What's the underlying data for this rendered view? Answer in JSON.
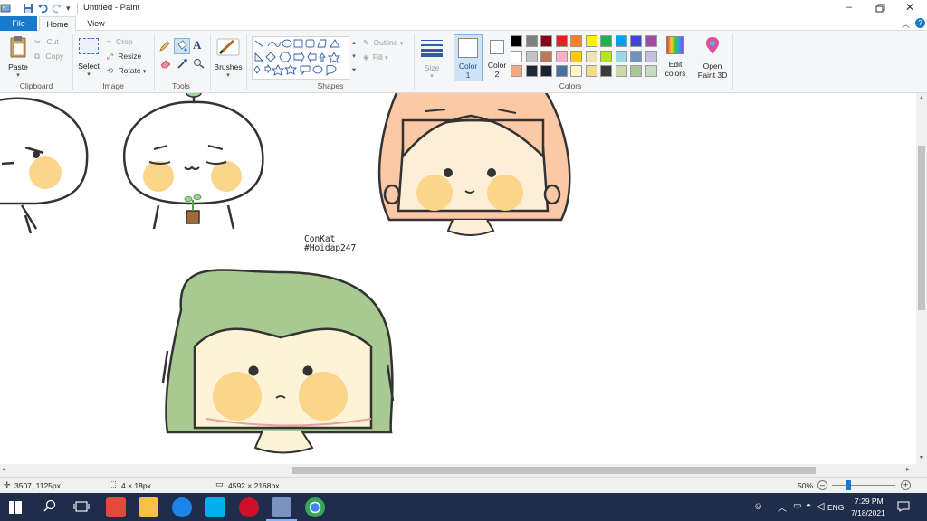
{
  "window": {
    "title": "Untitled - Paint"
  },
  "tabs": {
    "file": "File",
    "home": "Home",
    "view": "View"
  },
  "ribbon": {
    "clipboard": {
      "paste": "Paste",
      "cut": "Cut",
      "copy": "Copy",
      "label": "Clipboard"
    },
    "image": {
      "select": "Select",
      "crop": "Crop",
      "resize": "Resize",
      "rotate": "Rotate",
      "label": "Image"
    },
    "tools": {
      "label": "Tools"
    },
    "brushes": {
      "label": "Brushes"
    },
    "shapes": {
      "outline": "Outline",
      "fill": "Fill",
      "label": "Shapes"
    },
    "size": {
      "label": "Size"
    },
    "colors": {
      "color1": "Color",
      "color1_num": "1",
      "color2": "Color",
      "color2_num": "2",
      "edit": "Edit",
      "edit2": "colors",
      "label": "Colors",
      "row1": [
        "#000000",
        "#7f7f7f",
        "#880015",
        "#ed1c24",
        "#ff7f27",
        "#fff200",
        "#22b14c",
        "#00a2e8",
        "#3f48cc",
        "#a349a4"
      ],
      "row2": [
        "#ffffff",
        "#c3c3c3",
        "#b97a57",
        "#ffaec9",
        "#ffc90e",
        "#efe4b0",
        "#b5e61d",
        "#99d9ea",
        "#7092be",
        "#c8bfe7"
      ],
      "row3": [
        "#f4a880",
        "#1e2a3a",
        "#1a2233",
        "#4a6fa5",
        "#fff6cc",
        "#f7d98a",
        "#3a3a3a",
        "#cbd9a6",
        "#a8c89a",
        "#c6dcc0"
      ]
    },
    "paint3d": {
      "line1": "Open",
      "line2": "Paint 3D"
    }
  },
  "canvas": {
    "watermark_line1": "ConKat",
    "watermark_line2": "#Hoidap247"
  },
  "status": {
    "cursor_pos": "3507, 1125px",
    "selection_size": "4 × 18px",
    "image_size": "4592 × 2168px",
    "zoom": "50%"
  },
  "tray": {
    "lang": "ENG",
    "time": "7:29 PM",
    "date": "7/18/2021"
  }
}
